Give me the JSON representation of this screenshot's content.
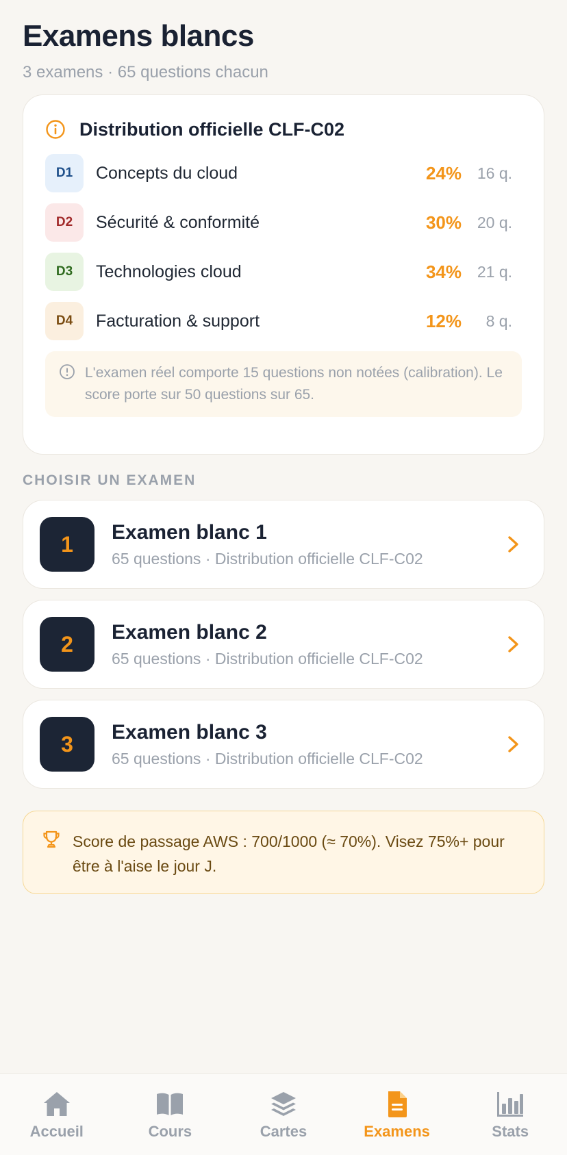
{
  "header": {
    "title": "Examens blancs",
    "subtitle": "3 examens · 65 questions chacun"
  },
  "distribution": {
    "title": "Distribution officielle CLF-C02",
    "domains": [
      {
        "code": "D1",
        "label": "Concepts du cloud",
        "percent": "24%",
        "questions": "16 q.",
        "bg": "#e6f0fb",
        "fg": "#1e4f8a"
      },
      {
        "code": "D2",
        "label": "Sécurité & conformité",
        "percent": "30%",
        "questions": "20 q.",
        "bg": "#fbe8e8",
        "fg": "#a12a2a"
      },
      {
        "code": "D3",
        "label": "Technologies cloud",
        "percent": "34%",
        "questions": "21 q.",
        "bg": "#e8f4e2",
        "fg": "#2f6b1f"
      },
      {
        "code": "D4",
        "label": "Facturation & support",
        "percent": "12%",
        "questions": "8 q.",
        "bg": "#fbefdf",
        "fg": "#7a4c12"
      }
    ],
    "note": "L'examen réel comporte 15 questions non notées (calibration). Le score porte sur 50 questions sur 65."
  },
  "exams_section": {
    "title": "CHOISIR UN EXAMEN",
    "exams": [
      {
        "number": "1",
        "title": "Examen blanc 1",
        "subtitle": "65 questions · Distribution officielle CLF-C02"
      },
      {
        "number": "2",
        "title": "Examen blanc 2",
        "subtitle": "65 questions · Distribution officielle CLF-C02"
      },
      {
        "number": "3",
        "title": "Examen blanc 3",
        "subtitle": "65 questions · Distribution officielle CLF-C02"
      }
    ]
  },
  "pass_info": {
    "text": "Score de passage AWS : 700/1000 (≈ 70%). Visez 75%+ pour être à l'aise le jour J."
  },
  "tabbar": {
    "tabs": [
      {
        "label": "Accueil",
        "icon": "home-icon",
        "active": false
      },
      {
        "label": "Cours",
        "icon": "book-icon",
        "active": false
      },
      {
        "label": "Cartes",
        "icon": "layers-icon",
        "active": false
      },
      {
        "label": "Examens",
        "icon": "document-icon",
        "active": true
      },
      {
        "label": "Stats",
        "icon": "bar-chart-icon",
        "active": false
      }
    ]
  },
  "colors": {
    "accent": "#f3951a",
    "dark": "#1c2535",
    "muted": "#9aa1ab"
  }
}
